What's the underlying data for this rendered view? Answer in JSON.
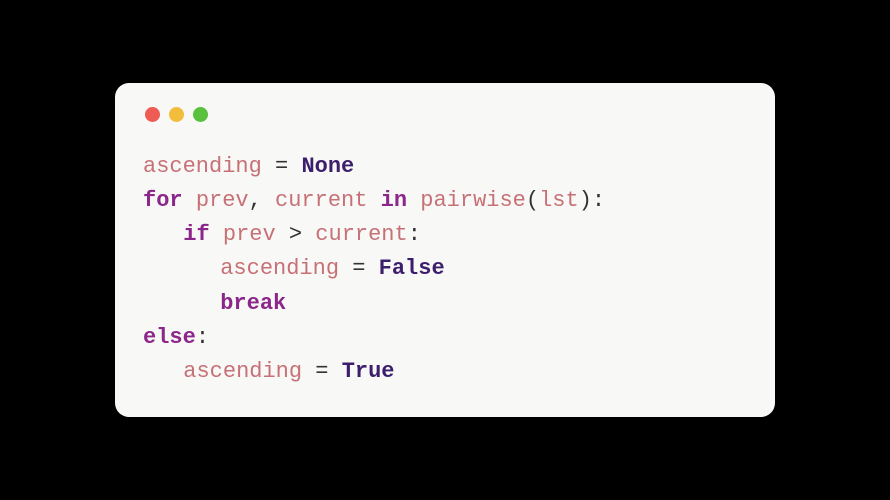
{
  "code": {
    "line1": {
      "var": "ascending",
      "op": " = ",
      "val": "None"
    },
    "line2": {
      "kw_for": "for",
      "sp1": " ",
      "var1": "prev",
      "comma": ", ",
      "var2": "current",
      "sp2": " ",
      "kw_in": "in",
      "sp3": " ",
      "fn": "pairwise",
      "lparen": "(",
      "arg": "lst",
      "rparen": "):"
    },
    "line3": {
      "kw_if": "if",
      "sp1": " ",
      "var1": "prev",
      "sp2": " ",
      "op": ">",
      "sp3": " ",
      "var2": "current",
      "colon": ":"
    },
    "line4": {
      "var": "ascending",
      "op": " = ",
      "val": "False"
    },
    "line5": {
      "kw": "break"
    },
    "line6": {
      "kw": "else",
      "colon": ":"
    },
    "line7": {
      "var": "ascending",
      "op": " = ",
      "val": "True"
    }
  }
}
